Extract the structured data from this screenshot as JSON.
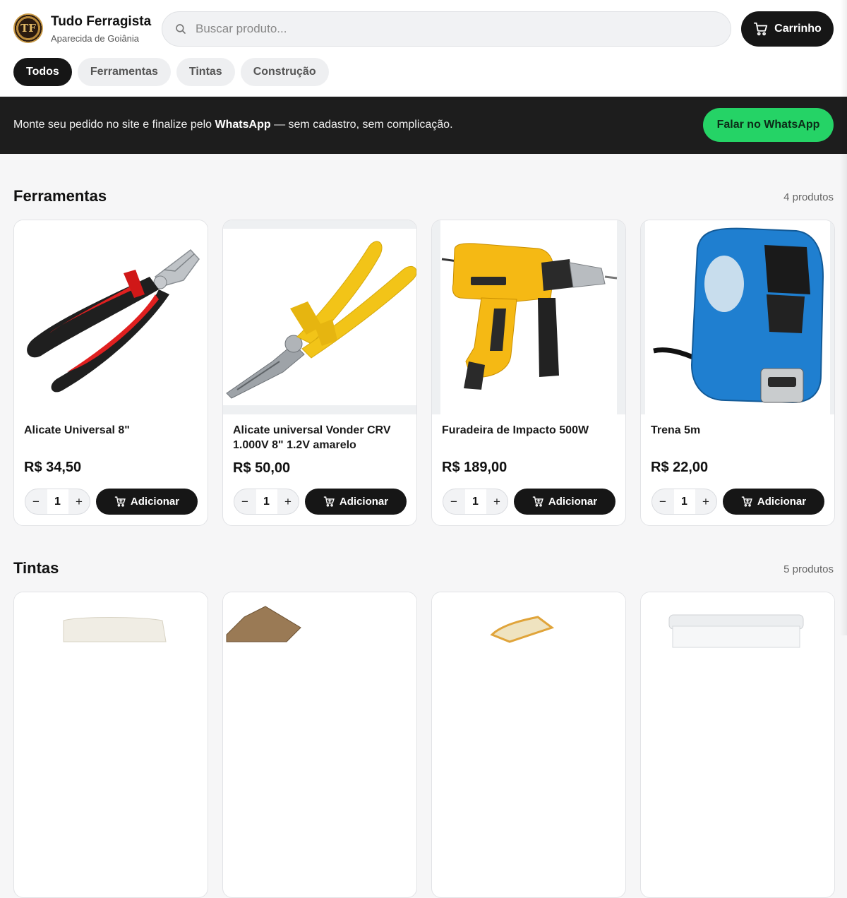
{
  "store": {
    "name": "Tudo Ferragista",
    "location": "Aparecida de Goiânia",
    "logo_text": "TF"
  },
  "search": {
    "placeholder": "Buscar produto...",
    "value": ""
  },
  "cart": {
    "label": "Carrinho"
  },
  "categories": [
    {
      "label": "Todos",
      "active": true
    },
    {
      "label": "Ferramentas",
      "active": false
    },
    {
      "label": "Tintas",
      "active": false
    },
    {
      "label": "Construção",
      "active": false
    }
  ],
  "banner": {
    "text_before": "Monte seu pedido no site e finalize pelo ",
    "text_bold": "WhatsApp",
    "text_after": " — sem cadastro, sem complicação.",
    "button_label": "Falar no WhatsApp"
  },
  "sections": [
    {
      "title": "Ferramentas",
      "count": "4 produtos",
      "products": [
        {
          "name": "Alicate Universal 8\"",
          "price": "R$ 34,50",
          "qty": "1",
          "add_label": "Adicionar",
          "image": "red-pliers"
        },
        {
          "name": "Alicate universal Vonder CRV 1.000V 8\" 1.2V amarelo",
          "price": "R$ 50,00",
          "qty": "1",
          "add_label": "Adicionar",
          "image": "yellow-pliers"
        },
        {
          "name": "Furadeira de Impacto 500W",
          "price": "R$ 189,00",
          "qty": "1",
          "add_label": "Adicionar",
          "image": "impact-drill"
        },
        {
          "name": "Trena 5m",
          "price": "R$ 22,00",
          "qty": "1",
          "add_label": "Adicionar",
          "image": "tape-measure"
        }
      ]
    },
    {
      "title": "Tintas",
      "count": "5 produtos",
      "products": [
        {
          "image": "white-fabric"
        },
        {
          "image": "paint-brush"
        },
        {
          "image": "paint-roller"
        },
        {
          "image": "paint-bucket"
        }
      ]
    }
  ],
  "colors": {
    "dark": "#161616",
    "whatsapp": "#25d366",
    "background": "#f6f6f7"
  }
}
